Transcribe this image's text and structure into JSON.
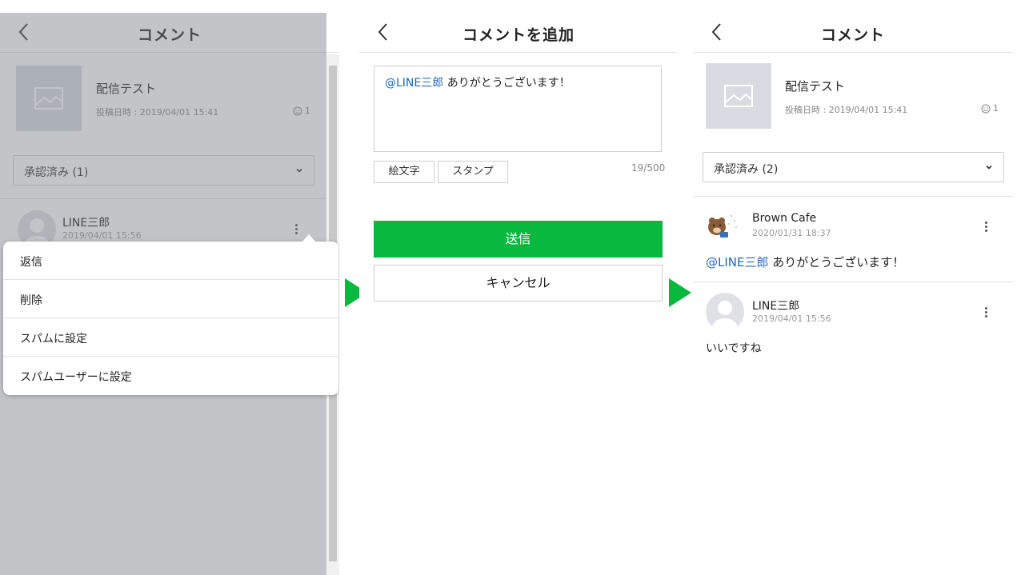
{
  "screen1": {
    "header": {
      "title": "コメント"
    },
    "post": {
      "title": "配信テスト",
      "date": "投稿日時 : 2019/04/01 15:41",
      "count": "1"
    },
    "filter": {
      "selected": "承認済み (1)"
    },
    "comment": {
      "author": "LINE三郎",
      "date": "2019/04/01 15:56"
    },
    "menu": {
      "items": [
        "返信",
        "削除",
        "スパムに設定",
        "スパムユーザーに設定"
      ]
    }
  },
  "screen2": {
    "header": {
      "title": "コメントを追加"
    },
    "input": {
      "mention": "@LINE三郎",
      "text": " ありがとうございます！"
    },
    "emoji_label": "絵文字",
    "sticker_label": "スタンプ",
    "counter": "19/500",
    "send_label": "送信",
    "cancel_label": "キャンセル"
  },
  "screen3": {
    "header": {
      "title": "コメント"
    },
    "post": {
      "title": "配信テスト",
      "date": "投稿日時 : 2019/04/01 15:41",
      "count": "1"
    },
    "filter": {
      "selected": "承認済み (2)"
    },
    "comments": [
      {
        "author": "Brown Cafe",
        "date": "2020/01/31 18:37",
        "mention": "@LINE三郎",
        "text": " ありがとうございます！"
      },
      {
        "author": "LINE三郎",
        "date": "2019/04/01 15:56",
        "text": "いいですね"
      }
    ]
  },
  "colors": {
    "accent_green": "#09b83e",
    "mention_blue": "#1e66c8"
  },
  "icons": [
    "back-arrow-icon",
    "image-placeholder-icon",
    "smiley-icon",
    "chevron-down-icon",
    "kebab-menu-icon",
    "flow-arrow-icon"
  ]
}
